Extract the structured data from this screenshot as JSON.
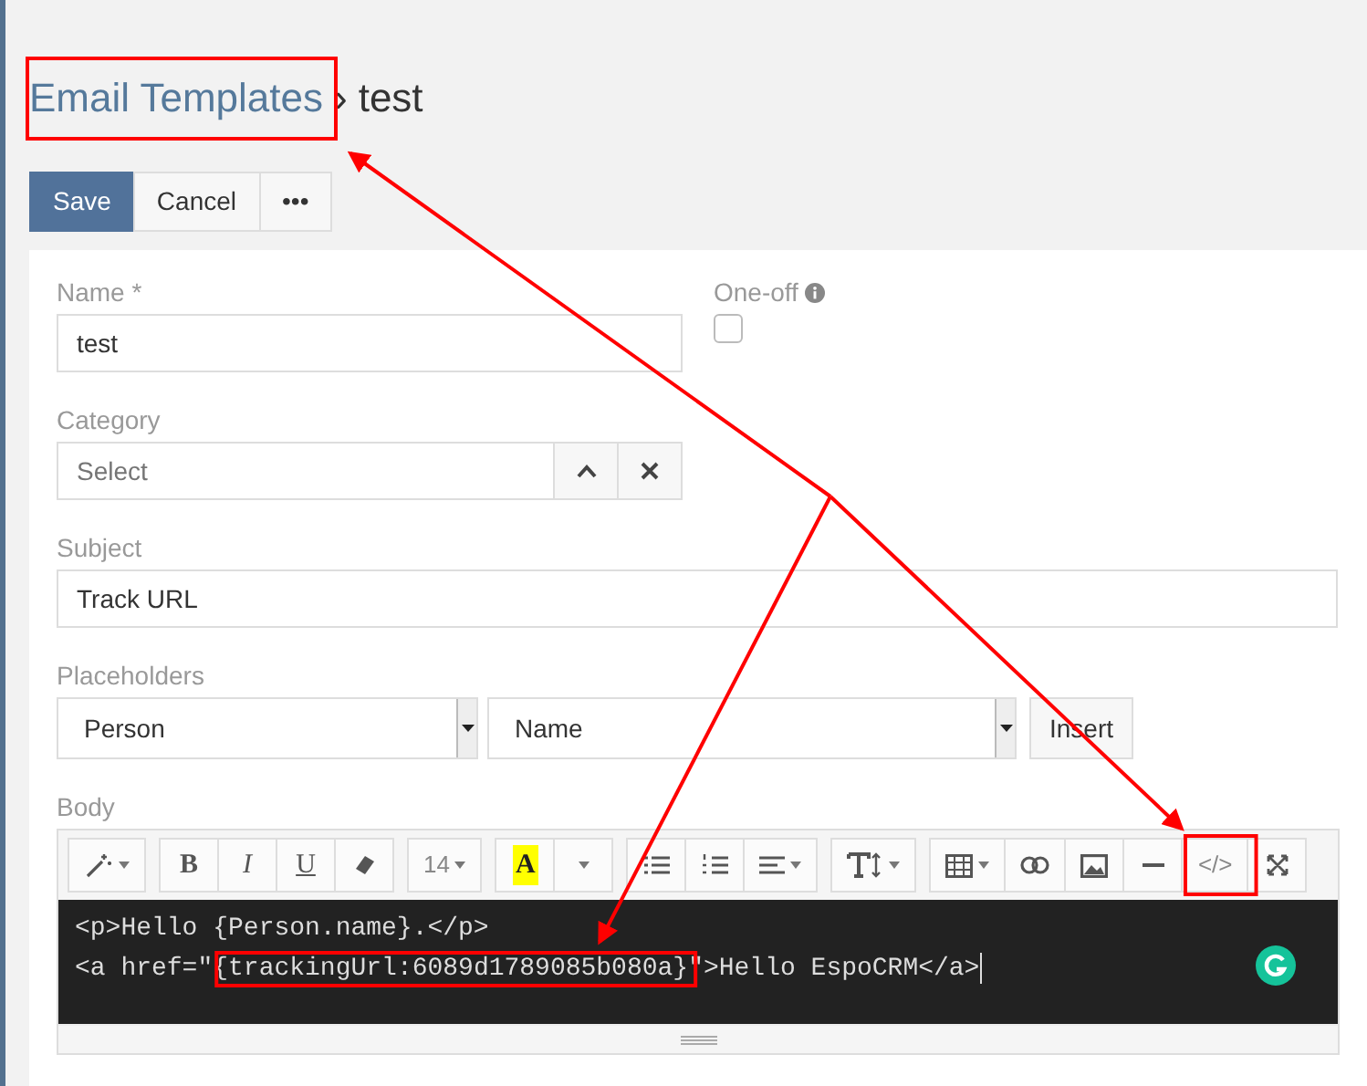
{
  "breadcrumb": {
    "parent": "Email Templates",
    "separator": "›",
    "current": "test"
  },
  "buttons": [
    {
      "label": "Save",
      "kind": "primary"
    },
    {
      "label": "Cancel",
      "kind": "default"
    },
    {
      "label": "•••",
      "kind": "default"
    }
  ],
  "name_field": {
    "label": "Name *",
    "value": "test"
  },
  "one_off": {
    "label": "One-off",
    "checked": false
  },
  "category": {
    "label": "Category",
    "placeholder": "Select"
  },
  "subject": {
    "label": "Subject",
    "value": "Track URL"
  },
  "placeholders": {
    "label": "Placeholders",
    "entity": "Person",
    "field": "Name",
    "button": "Insert"
  },
  "body": {
    "label": "Body",
    "toolbar": [
      [
        {
          "kind": "magic",
          "dropdown": true
        }
      ],
      [
        {
          "kind": "bold",
          "label": "B"
        },
        {
          "kind": "italic",
          "label": "I"
        },
        {
          "kind": "underline",
          "label": "U"
        },
        {
          "kind": "eraser"
        }
      ],
      [
        {
          "kind": "text",
          "label": "14",
          "dropdown": true
        }
      ],
      [
        {
          "kind": "color",
          "label": "A"
        },
        {
          "kind": "caret"
        }
      ],
      [
        {
          "kind": "bullets"
        },
        {
          "kind": "numbers"
        },
        {
          "kind": "align",
          "dropdown": true
        }
      ],
      [
        {
          "kind": "text-height",
          "dropdown": true
        }
      ],
      [
        {
          "kind": "table",
          "dropdown": true
        },
        {
          "kind": "link"
        },
        {
          "kind": "image"
        },
        {
          "kind": "rule"
        },
        {
          "kind": "text",
          "label": "</>"
        },
        {
          "kind": "fullscreen"
        }
      ]
    ],
    "code_lines": [
      [
        {
          "text": "<p>Hello {Person.name}.</p>",
          "highlighted": false
        }
      ],
      [
        {
          "text": "<a href=\"",
          "highlighted": false
        },
        {
          "text": "{trackingUrl:6089d1789085b080a}",
          "highlighted": true
        },
        {
          "text": "\">Hello EspoCRM</a>",
          "highlighted": false
        }
      ]
    ]
  }
}
